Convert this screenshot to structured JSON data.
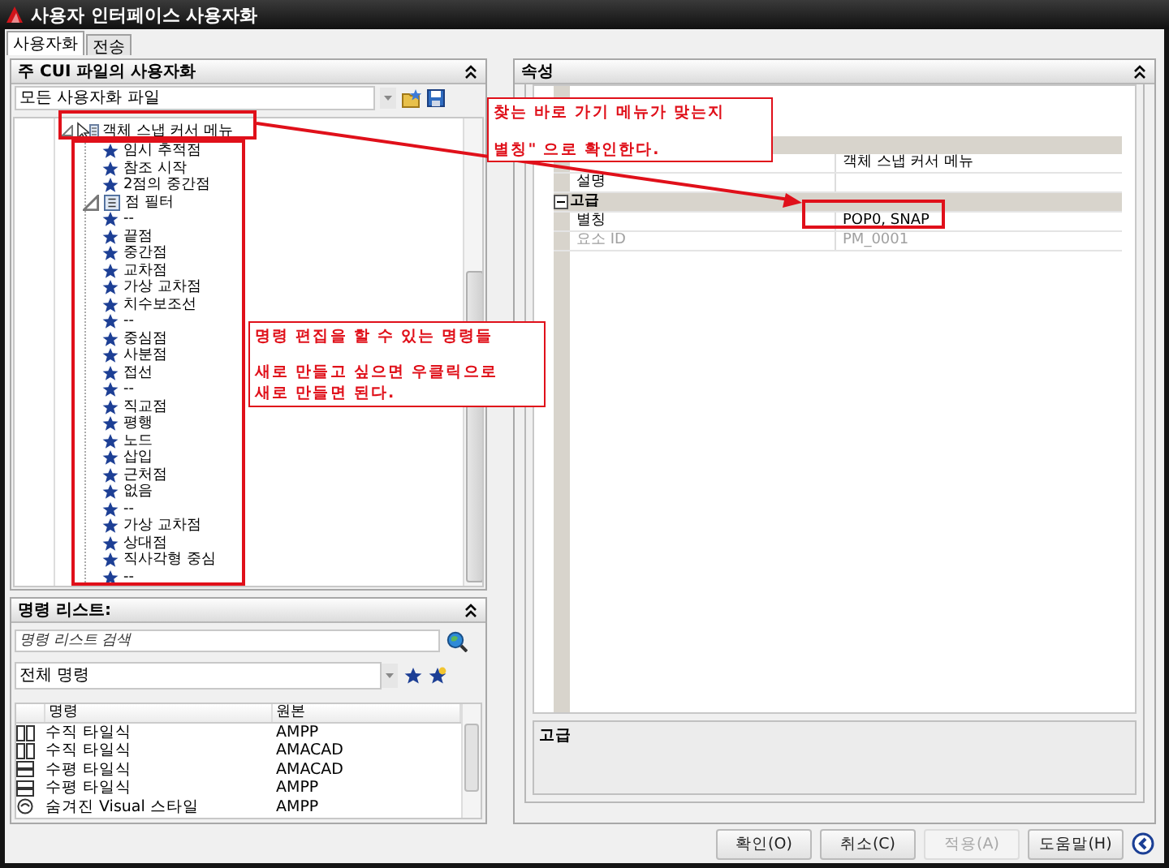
{
  "window": {
    "title": "사용자 인터페이스 사용자화"
  },
  "tabs": [
    {
      "label": "사용자화",
      "selected": true
    },
    {
      "label": "전송",
      "selected": false
    }
  ],
  "cui_panel": {
    "title": "주 CUI 파일의 사용자화",
    "file_filter": "모든 사용자화 파일",
    "tree": [
      {
        "label": "객체 스냅 커서 메뉴",
        "kind": "menu",
        "expanded": true,
        "children": [
          {
            "label": "임시 추적점",
            "kind": "command"
          },
          {
            "label": "참조 시작",
            "kind": "command"
          },
          {
            "label": "2점의 중간점",
            "kind": "command"
          },
          {
            "label": "점 필터",
            "kind": "submenu",
            "expanded": true
          },
          {
            "label": "--",
            "kind": "command"
          },
          {
            "label": "끝점",
            "kind": "command"
          },
          {
            "label": "중간점",
            "kind": "command"
          },
          {
            "label": "교차점",
            "kind": "command"
          },
          {
            "label": "가상 교차점",
            "kind": "command"
          },
          {
            "label": "치수보조선",
            "kind": "command"
          },
          {
            "label": "--",
            "kind": "command"
          },
          {
            "label": "중심점",
            "kind": "command"
          },
          {
            "label": "사분점",
            "kind": "command"
          },
          {
            "label": "접선",
            "kind": "command"
          },
          {
            "label": "--",
            "kind": "command"
          },
          {
            "label": "직교점",
            "kind": "command"
          },
          {
            "label": "평행",
            "kind": "command"
          },
          {
            "label": "노드",
            "kind": "command"
          },
          {
            "label": "삽입",
            "kind": "command"
          },
          {
            "label": "근처점",
            "kind": "command"
          },
          {
            "label": "없음",
            "kind": "command"
          },
          {
            "label": "--",
            "kind": "command"
          },
          {
            "label": "가상 교차점",
            "kind": "command"
          },
          {
            "label": "상대점",
            "kind": "command"
          },
          {
            "label": "직사각형 중심",
            "kind": "command"
          },
          {
            "label": "--",
            "kind": "command"
          }
        ]
      }
    ]
  },
  "command_list": {
    "title": "명령 리스트:",
    "search": {
      "placeholder": "명령 리스트 검색"
    },
    "filter": "전체 명령",
    "columns": [
      "명령",
      "원본"
    ],
    "rows": [
      {
        "kind": "vtile",
        "name": "수직 타일식",
        "source": "AMPP"
      },
      {
        "kind": "vtile",
        "name": "수직 타일식",
        "source": "AMACAD"
      },
      {
        "kind": "htile",
        "name": "수평 타일식",
        "source": "AMACAD"
      },
      {
        "kind": "htile",
        "name": "수평 타일식",
        "source": "AMPP"
      },
      {
        "kind": "visual",
        "name": "숨겨진 Visual 스타일",
        "source": "AMPP"
      }
    ]
  },
  "properties": {
    "title": "속성",
    "rows": [
      {
        "kind": "header"
      },
      {
        "kind": "field",
        "value": "객체 스냅 커서 메뉴",
        "disabled": false
      },
      {
        "kind": "field",
        "label": "설명",
        "disabled": false
      },
      {
        "kind": "category",
        "label": "고급",
        "expanded": true
      },
      {
        "kind": "field",
        "label": "별칭",
        "value": "POP0, SNAP",
        "disabled": false
      },
      {
        "kind": "field",
        "label": "요소 ID",
        "value": "PM_0001",
        "disabled": true
      }
    ],
    "description": {
      "title": "고급"
    }
  },
  "buttons": [
    {
      "label": "확인(O)",
      "disabled": false
    },
    {
      "label": "취소(C)",
      "disabled": false
    },
    {
      "label": "적용(A)",
      "disabled": true
    },
    {
      "label": "도움말(H)",
      "disabled": false
    }
  ],
  "annotations": [
    {
      "paragraphs": [
        [
          "찾는 바로 가기 메뉴가 맞는지"
        ],
        [
          "별칭\" 으로 확인한다."
        ]
      ]
    },
    {
      "paragraphs": [
        [
          "명령 편집을 할 수 있는 명령들"
        ],
        [
          "새로 만들고 싶으면 우클릭으로",
          "새로 만들면 된다."
        ]
      ]
    }
  ]
}
